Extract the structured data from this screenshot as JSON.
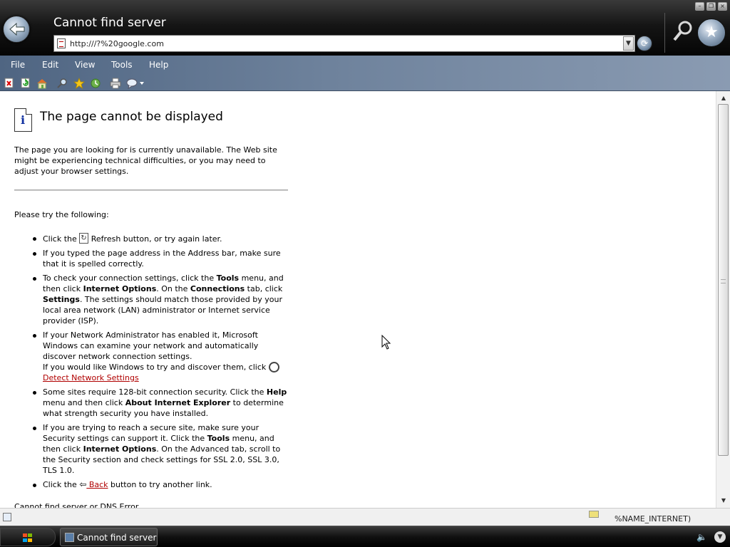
{
  "window": {
    "title": "Cannot find server",
    "address": "http:///?%20google.com",
    "controls": [
      "minimize",
      "restore",
      "close"
    ]
  },
  "menu": {
    "items": [
      "File",
      "Edit",
      "View",
      "Tools",
      "Help"
    ]
  },
  "toolbar": {
    "icons": [
      "stop-icon",
      "refresh-icon",
      "home-icon",
      "search-icon",
      "favorites-icon",
      "history-icon",
      "print-icon",
      "messenger-icon"
    ]
  },
  "page": {
    "title": "The page cannot be displayed",
    "intro": "The page you are looking for is currently unavailable. The Web site might be experiencing technical difficulties, or you may need to adjust your browser settings.",
    "try_heading": "Please try the following:",
    "item1_pre": "Click the ",
    "item1_post": " Refresh button, or try again later.",
    "item2": "If you typed the page address in the Address bar, make sure that it is spelled correctly.",
    "item3_a": "To check your connection settings, click the ",
    "item3_tools": "Tools",
    "item3_b": " menu, and then click ",
    "item3_internet_options": "Internet Options",
    "item3_c": ". On the ",
    "item3_connections": "Connections",
    "item3_d": " tab, click ",
    "item3_settings": "Settings",
    "item3_e": ". The settings should match those provided by your local area network (LAN) administrator or Internet service provider (ISP).",
    "item4_a": "If your Network Administrator has enabled it, Microsoft Windows can examine your network and automatically discover network connection settings.",
    "item4_b": "If you would like Windows to try and discover them, click ",
    "item4_link": " Detect Network Settings",
    "item5_a": "Some sites require 128-bit connection security. Click the ",
    "item5_help": "Help",
    "item5_b": " menu and then click ",
    "item5_about": "About Internet Explorer",
    "item5_c": " to determine what strength security you have installed.",
    "item6_a": "If you are trying to reach a secure site, make sure your Security settings can support it. Click the ",
    "item6_tools": "Tools",
    "item6_b": " menu, and then click ",
    "item6_internet_options": "Internet Options",
    "item6_c": ". On the Advanced tab, scroll to the Security section and check settings for SSL 2.0, SSL 3.0, TLS 1.0.",
    "item7_pre": "Click the ",
    "item7_link": " Back",
    "item7_post": " button to try another link.",
    "footer": "Cannot find server or DNS Error"
  },
  "status": {
    "zone": "%NAME_INTERNET)"
  },
  "taskbar": {
    "task_label": "Cannot find server"
  },
  "colors": {
    "link": "#b00000",
    "menubar": "#6e829c"
  }
}
